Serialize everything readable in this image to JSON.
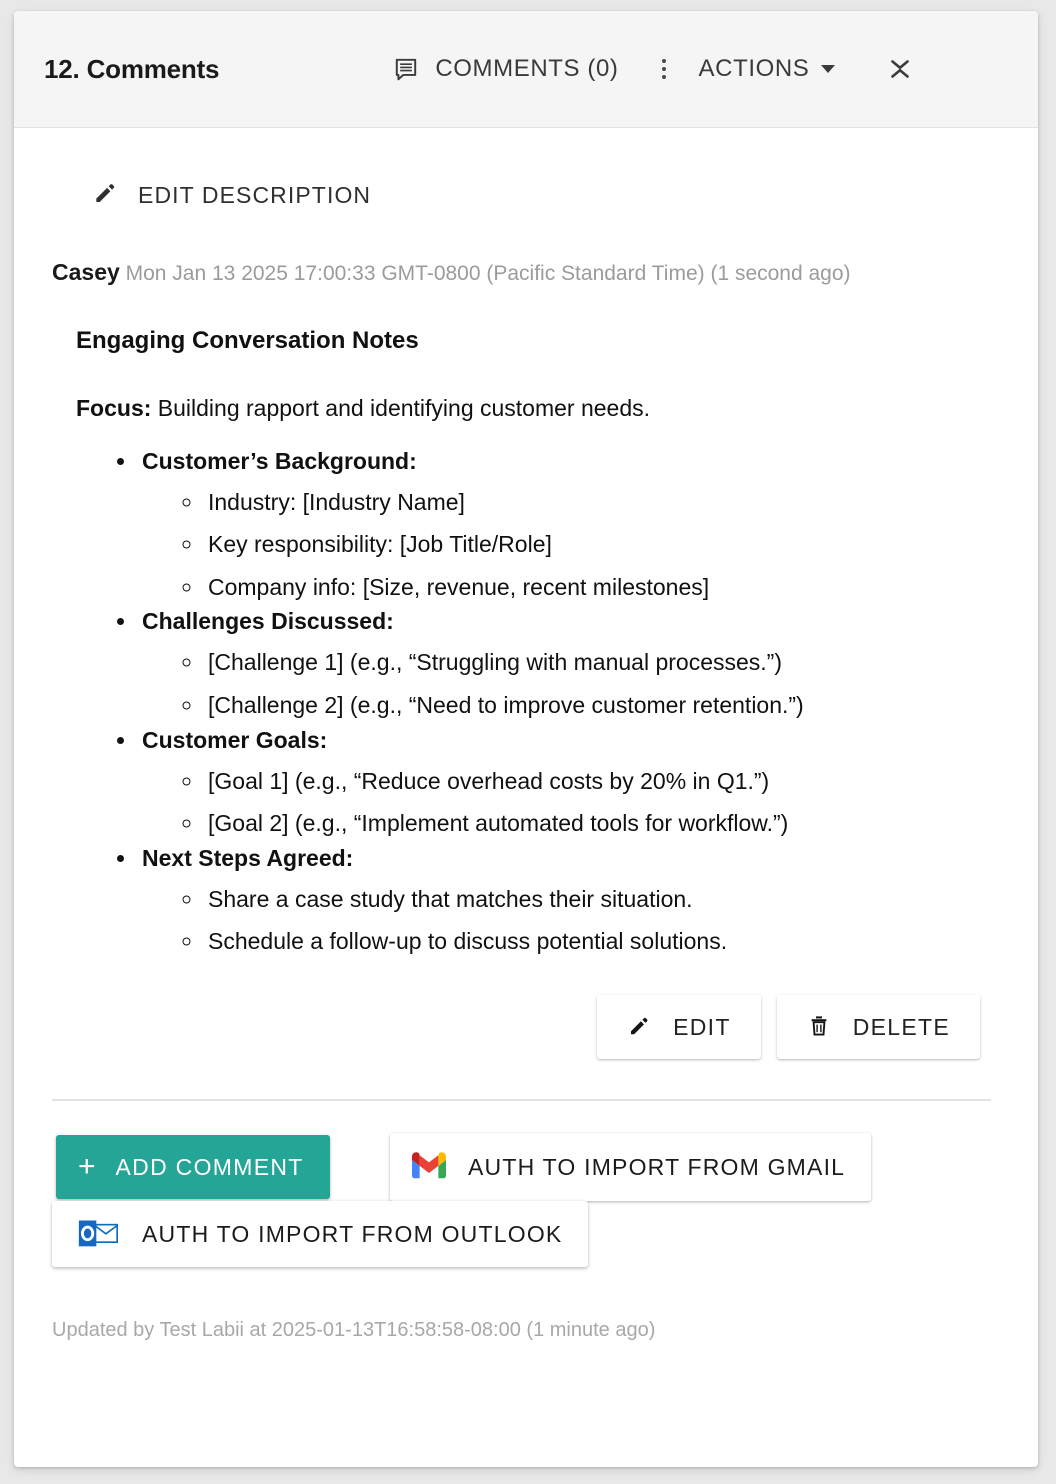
{
  "header": {
    "title": "12. Comments",
    "comments_label": "COMMENTS (0)",
    "comments_icon": "comment-icon",
    "kebab_icon": "more-vertical-icon",
    "actions_label": "ACTIONS",
    "actions_caret_icon": "chevron-down-icon",
    "collapse_icon": "collapse-icon"
  },
  "body": {
    "edit_description_label": "EDIT DESCRIPTION",
    "edit_description_icon": "pencil-icon",
    "comment": {
      "author": "Casey",
      "timestamp": "Mon Jan 13 2025 17:00:33 GMT-0800 (Pacific Standard Time) (1 second ago)",
      "title": "Engaging Conversation Notes",
      "focus_label": "Focus:",
      "focus_text": " Building rapport and identifying customer needs.",
      "sections": [
        {
          "label": "Customer’s Background:",
          "items": [
            "Industry: [Industry Name]",
            "Key responsibility: [Job Title/Role]",
            "Company info: [Size, revenue, recent milestones]"
          ]
        },
        {
          "label": "Challenges Discussed:",
          "items": [
            "[Challenge 1] (e.g., “Struggling with manual processes.”)",
            "[Challenge 2] (e.g., “Need to improve customer retention.”)"
          ]
        },
        {
          "label": "Customer Goals:",
          "items": [
            "[Goal 1] (e.g., “Reduce overhead costs by 20% in Q1.”)",
            "[Goal 2] (e.g., “Implement automated tools for workflow.”)"
          ]
        },
        {
          "label": "Next Steps Agreed:",
          "items": [
            "Share a case study that matches their situation.",
            "Schedule a follow-up to discuss potential solutions."
          ]
        }
      ],
      "edit_button_label": "EDIT",
      "edit_button_icon": "pencil-icon",
      "delete_button_label": "DELETE",
      "delete_button_icon": "trash-icon"
    }
  },
  "footer": {
    "add_comment_label": "ADD COMMENT",
    "add_comment_icon": "plus-icon",
    "gmail_label": "AUTH TO IMPORT FROM GMAIL",
    "gmail_icon": "gmail-icon",
    "outlook_label": "AUTH TO IMPORT FROM OUTLOOK",
    "outlook_icon": "outlook-icon",
    "updated_text": "Updated by Test Labii at 2025-01-13T16:58:58-08:00 (1 minute ago)"
  },
  "colors": {
    "accent_teal": "#25a596",
    "header_bg": "#f5f5f5",
    "muted_text": "#9b9b9b",
    "card_bg": "#ffffff"
  }
}
